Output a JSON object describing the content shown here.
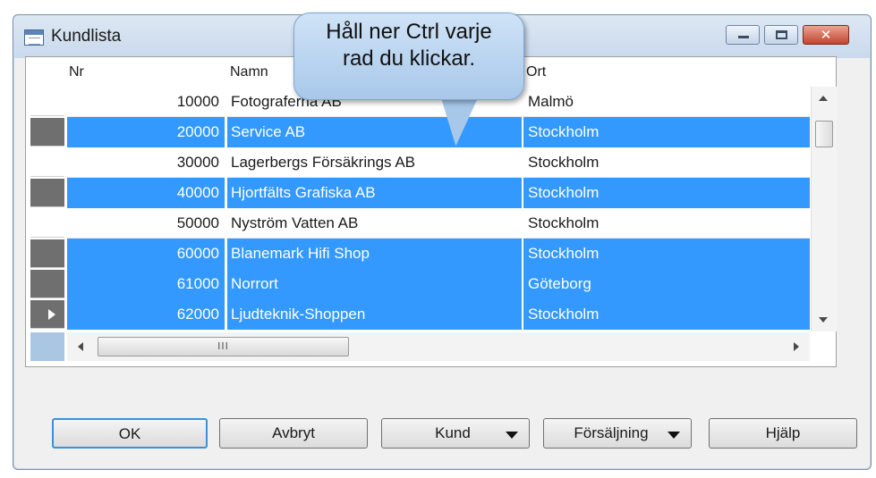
{
  "window": {
    "title": "Kundlista"
  },
  "grid": {
    "columns": [
      "Nr",
      "Namn",
      "Ort"
    ],
    "rows": [
      {
        "nr": "10000",
        "namn": "Fotograferna AB",
        "ort": "Malmö",
        "selected": false
      },
      {
        "nr": "20000",
        "namn": "Service AB",
        "ort": "Stockholm",
        "selected": true
      },
      {
        "nr": "30000",
        "namn": "Lagerbergs Försäkrings AB",
        "ort": "Stockholm",
        "selected": false
      },
      {
        "nr": "40000",
        "namn": "Hjortfälts Grafiska AB",
        "ort": "Stockholm",
        "selected": true
      },
      {
        "nr": "50000",
        "namn": "Nyström Vatten AB",
        "ort": "Stockholm",
        "selected": false
      },
      {
        "nr": "60000",
        "namn": "Blanemark Hifi Shop",
        "ort": "Stockholm",
        "selected": true
      },
      {
        "nr": "61000",
        "namn": "Norrort",
        "ort": "Göteborg",
        "selected": true
      },
      {
        "nr": "62000",
        "namn": "Ljudteknik-Shoppen",
        "ort": "Stockholm",
        "selected": true,
        "current": true
      }
    ],
    "hscroll_thumb_text": "III"
  },
  "callout": {
    "line1": "Håll ner Ctrl varje",
    "line2": "rad du klickar."
  },
  "buttons": {
    "ok": "OK",
    "avbryt": "Avbryt",
    "kund": "Kund",
    "forsaljning": "Försäljning",
    "hjalp": "Hjälp"
  }
}
